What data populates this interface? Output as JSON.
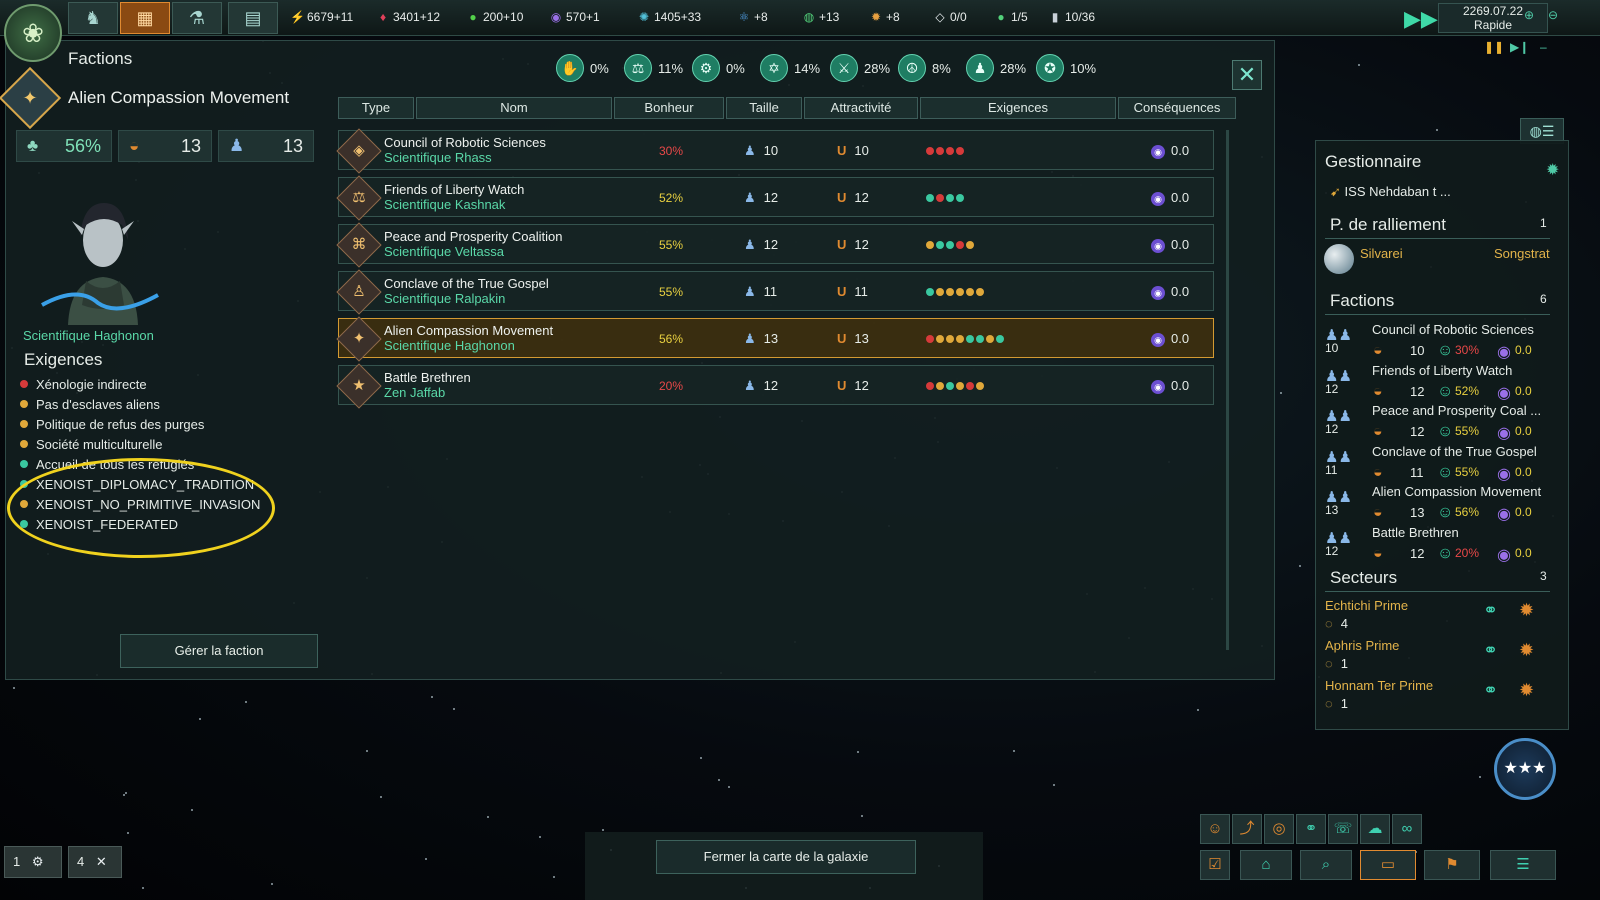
{
  "topbar": {
    "resources": [
      {
        "icon": "energy-icon",
        "glyph": "⚡",
        "value": "6679+11",
        "color": "#f2c84a"
      },
      {
        "icon": "minerals-icon",
        "glyph": "♦",
        "value": "3401+12",
        "color": "#e0405a"
      },
      {
        "icon": "food-icon",
        "glyph": "●",
        "value": "200+10",
        "color": "#52d04a"
      },
      {
        "icon": "influence-icon",
        "glyph": "◉",
        "value": "570+1",
        "color": "#9a70e8"
      },
      {
        "icon": "unity-icon",
        "glyph": "✺",
        "value": "1405+33",
        "color": "#52c0d8"
      },
      {
        "icon": "physics-icon",
        "glyph": "⚛",
        "value": "+8",
        "color": "#52a0e8"
      },
      {
        "icon": "society-icon",
        "glyph": "◍",
        "value": "+13",
        "color": "#52d07a"
      },
      {
        "icon": "engineering-icon",
        "glyph": "✹",
        "value": "+8",
        "color": "#e8a040"
      },
      {
        "icon": "strategic-icon",
        "glyph": "◇",
        "value": "0/0",
        "color": "#e8eef0"
      },
      {
        "icon": "planets-icon",
        "glyph": "●",
        "value": "1/5",
        "color": "#52d07a"
      },
      {
        "icon": "fleet-icon",
        "glyph": "▮",
        "value": "10/36",
        "color": "#c8d0d8"
      }
    ],
    "date": "2269.07.22",
    "speed": "Rapide"
  },
  "window": {
    "title": "Factions",
    "ethics": [
      {
        "icon": "ethic-xenophile-icon",
        "glyph": "✋",
        "pct": "0%"
      },
      {
        "icon": "ethic-egalitarian-icon",
        "glyph": "⚖",
        "pct": "11%"
      },
      {
        "icon": "ethic-materialist-icon",
        "glyph": "⚙",
        "pct": "0%"
      },
      {
        "icon": "ethic-spiritualist-icon",
        "glyph": "✡",
        "pct": "14%"
      },
      {
        "icon": "ethic-militarist-icon",
        "glyph": "⚔",
        "pct": "28%"
      },
      {
        "icon": "ethic-pacifist-icon",
        "glyph": "☮",
        "pct": "8%"
      },
      {
        "icon": "ethic-authoritarian-icon",
        "glyph": "♟",
        "pct": "28%"
      },
      {
        "icon": "ethic-xenophobe-icon",
        "glyph": "✪",
        "pct": "10%"
      }
    ],
    "selected": {
      "name": "Alien Compassion Movement",
      "happiness": "56%",
      "influence": "13",
      "size": "13",
      "leader": "Scientifique Haghonon",
      "req_title": "Exigences",
      "requirements": [
        {
          "text": "Xénologie indirecte",
          "color": "#d63a3a"
        },
        {
          "text": "Pas d'esclaves aliens",
          "color": "#e0a83a"
        },
        {
          "text": "Politique de refus des purges",
          "color": "#e0a83a"
        },
        {
          "text": "Société multiculturelle",
          "color": "#e0a83a"
        },
        {
          "text": "Accueil de tous les réfugiés",
          "color": "#3ac8a0"
        },
        {
          "text": "XENOIST_DIPLOMACY_TRADITION",
          "color": "#3ac8a0"
        },
        {
          "text": "XENOIST_NO_PRIMITIVE_INVASION",
          "color": "#e0a83a"
        },
        {
          "text": "XENOIST_FEDERATED",
          "color": "#3ac8a0"
        }
      ],
      "manage_label": "Gérer la faction"
    },
    "columns": [
      "Type",
      "Nom",
      "Bonheur",
      "Taille",
      "Attractivité",
      "Exigences",
      "Conséquences"
    ],
    "factions": [
      {
        "name": "Council of Robotic Sciences",
        "leader": "Scientifique Rhass",
        "happiness": "30%",
        "hap_color": "#e84848",
        "size": "10",
        "attraction": "10",
        "consequence": "0.0",
        "glyph": "◈",
        "dots": [
          "#d63a3a",
          "#d63a3a",
          "#d63a3a",
          "#d63a3a"
        ]
      },
      {
        "name": "Friends of Liberty Watch",
        "leader": "Scientifique Kashnak",
        "happiness": "52%",
        "hap_color": "#e8d040",
        "size": "12",
        "attraction": "12",
        "consequence": "0.0",
        "glyph": "⚖",
        "dots": [
          "#3ac8a0",
          "#d63a3a",
          "#3ac8a0",
          "#3ac8a0"
        ]
      },
      {
        "name": "Peace and Prosperity Coalition",
        "leader": "Scientifique Veltassa",
        "happiness": "55%",
        "hap_color": "#e8d040",
        "size": "12",
        "attraction": "12",
        "consequence": "0.0",
        "glyph": "⌘",
        "dots": [
          "#e0a83a",
          "#3ac8a0",
          "#3ac8a0",
          "#d63a3a",
          "#e0a83a"
        ]
      },
      {
        "name": "Conclave of the True Gospel",
        "leader": "Scientifique Ralpakin",
        "happiness": "55%",
        "hap_color": "#e8d040",
        "size": "11",
        "attraction": "11",
        "consequence": "0.0",
        "glyph": "♙",
        "dots": [
          "#3ac8a0",
          "#e0a83a",
          "#e0a83a",
          "#e0a83a",
          "#e0a83a",
          "#e0a83a"
        ]
      },
      {
        "name": "Alien Compassion Movement",
        "leader": "Scientifique Haghonon",
        "happiness": "56%",
        "hap_color": "#e8d040",
        "size": "13",
        "attraction": "13",
        "consequence": "0.0",
        "glyph": "✦",
        "dots": [
          "#d63a3a",
          "#e0a83a",
          "#e0a83a",
          "#e0a83a",
          "#3ac8a0",
          "#3ac8a0",
          "#e0a83a",
          "#3ac8a0"
        ]
      },
      {
        "name": "Battle Brethren",
        "leader": "Zen Jaffab",
        "happiness": "20%",
        "hap_color": "#e84848",
        "size": "12",
        "attraction": "12",
        "consequence": "0.0",
        "glyph": "★",
        "dots": [
          "#d63a3a",
          "#e0a83a",
          "#3ac8a0",
          "#e0a83a",
          "#d63a3a",
          "#e0a83a"
        ]
      }
    ]
  },
  "outliner": {
    "manager_title": "Gestionnaire",
    "ship": "ISS Nehdaban t ...",
    "rally_title": "P. de ralliement",
    "rally_count": "1",
    "rally_system": "Silvarei",
    "rally_right": "Songstrat",
    "factions_title": "Factions",
    "factions_count": "6",
    "factions": [
      {
        "name": "Council of Robotic Sciences",
        "size": "10",
        "inf": "10",
        "hap": "30%",
        "hap_color": "#e84848",
        "cons": "0.0"
      },
      {
        "name": "Friends of Liberty Watch",
        "size": "12",
        "inf": "12",
        "hap": "52%",
        "hap_color": "#e8d040",
        "cons": "0.0"
      },
      {
        "name": "Peace and Prosperity Coal ...",
        "size": "12",
        "inf": "12",
        "hap": "55%",
        "hap_color": "#e8d040",
        "cons": "0.0"
      },
      {
        "name": "Conclave of the True Gospel",
        "size": "11",
        "inf": "11",
        "hap": "55%",
        "hap_color": "#e8d040",
        "cons": "0.0"
      },
      {
        "name": "Alien Compassion Movement",
        "size": "13",
        "inf": "13",
        "hap": "56%",
        "hap_color": "#e8d040",
        "cons": "0.0"
      },
      {
        "name": "Battle Brethren",
        "size": "12",
        "inf": "12",
        "hap": "20%",
        "hap_color": "#e84848",
        "cons": "0.0"
      }
    ],
    "sectors_title": "Secteurs",
    "sectors_count": "3",
    "sectors": [
      {
        "name": "Echtichi Prime",
        "count": "4"
      },
      {
        "name": "Aphris Prime",
        "count": "1"
      },
      {
        "name": "Honnam Ter Prime",
        "count": "1"
      }
    ]
  },
  "bottom": {
    "close_map": "Fermer la carte de la galaxie",
    "left_box_1": "1",
    "left_box_2": "4"
  }
}
